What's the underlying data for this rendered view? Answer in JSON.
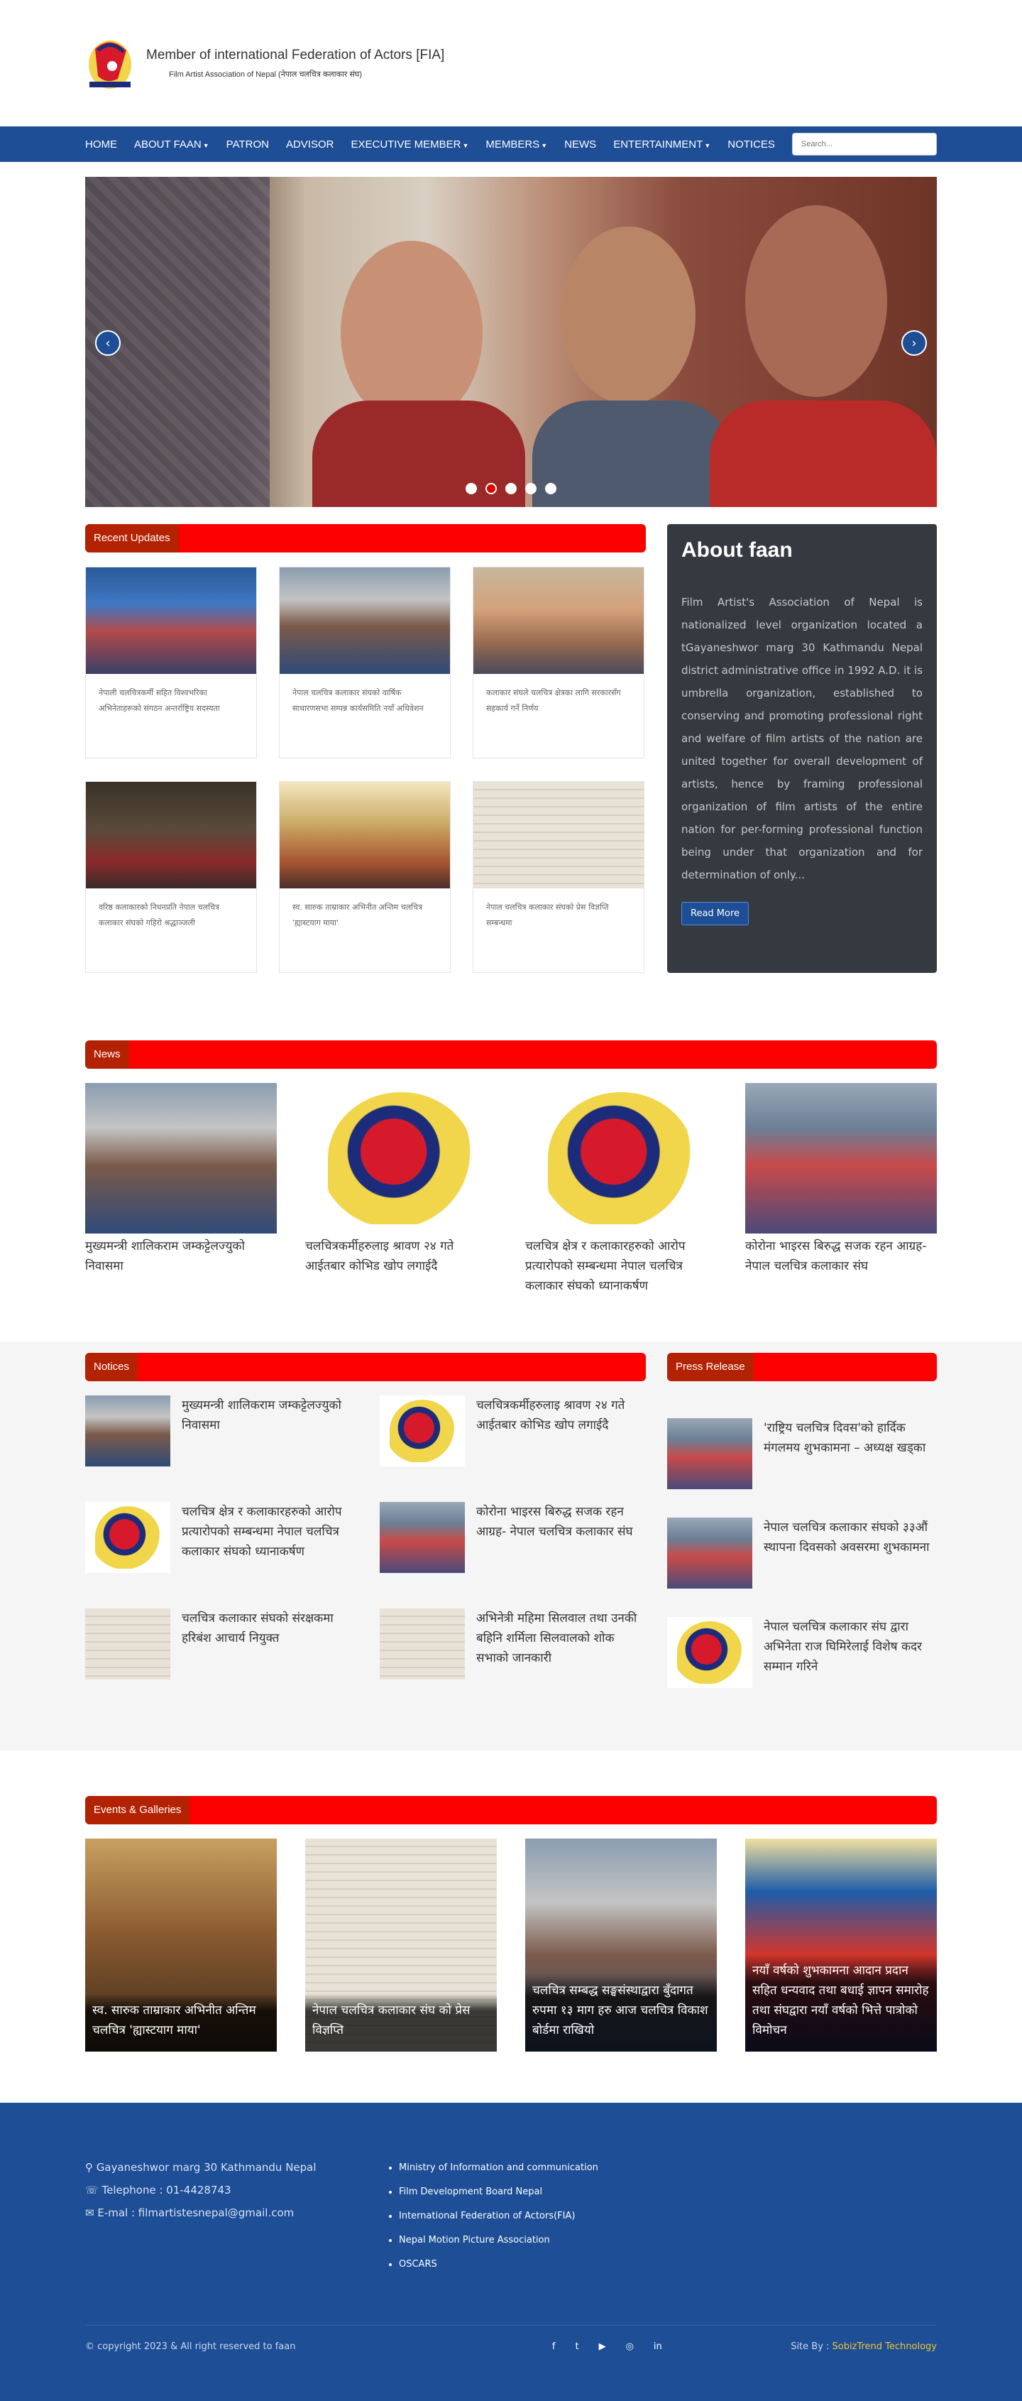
{
  "header": {
    "title": "Member of international Federation of Actors [FIA]",
    "subtitle": "Film Artist Association of Nepal (नेपाल चलचित्र कलाकार संघ)"
  },
  "nav": {
    "items": [
      {
        "label": "HOME",
        "dropdown": false
      },
      {
        "label": "ABOUT FAAN",
        "dropdown": true
      },
      {
        "label": "PATRON",
        "dropdown": false
      },
      {
        "label": "ADVISOR",
        "dropdown": false
      },
      {
        "label": "EXECUTIVE MEMBER",
        "dropdown": true
      },
      {
        "label": "MEMBERS",
        "dropdown": true
      },
      {
        "label": "NEWS",
        "dropdown": false
      },
      {
        "label": "ENTERTAINMENT",
        "dropdown": true
      },
      {
        "label": "NOTICES",
        "dropdown": false
      }
    ],
    "search_placeholder": "Search..."
  },
  "hero": {
    "prev_icon": "‹",
    "next_icon": "›",
    "slide_count": 5,
    "active_index": 1
  },
  "recent_updates": {
    "title": "Recent Updates",
    "cards": [
      {
        "text": "नेपाली चलचित्रकर्मी सहित विश्वभरिका अभिनेताहरूको संगठन अन्तर्राष्ट्रिय सदस्यता"
      },
      {
        "text": "नेपाल चलचित्र कलाकार संघको वार्षिक साधारणसभा सम्पन्न कार्यसमिति नयाँ अधिवेशन"
      },
      {
        "text": "कलाकार संघले चलचित्र क्षेत्रका लागि सरकारसँग सहकार्य गर्ने निर्णय"
      },
      {
        "text": "वरिष्ठ कलाकारको निधनप्रति नेपाल चलचित्र कलाकार संघको गहिरो श्रद्धाञ्जली"
      },
      {
        "text": "स्व. सारुक ताम्राकार अभिनीत अन्तिम चलचित्र 'ह्यास्टयाग माया'"
      },
      {
        "text": "नेपाल चलचित्र कलाकार संघको प्रेस विज्ञप्ति सम्बन्धमा"
      }
    ]
  },
  "about": {
    "title": "About faan",
    "text": "Film Artist's Association of Nepal is nationalized level organization located a tGayaneshwor marg 30 Kathmandu Nepal district administrative office in 1992 A.D. it is umbrella organization, established to conserving and promoting professional right and welfare of film artists of the nation are united together for overall development of artists, hence by framing professional organization of film artists of the entire nation for per-forming professional function being under that organization and for determination of only...",
    "button": "Read More"
  },
  "news": {
    "title": "News",
    "items": [
      {
        "title": "मुख्यमन्त्री शालिकराम जम्कट्टेलज्युको निवासमा",
        "image": "ph-group"
      },
      {
        "title": "चलचित्रकर्मीहरुलाइ श्रावण २४ गते आईतबार कोभिड खोप लगाईदै",
        "image": "ph-logo"
      },
      {
        "title": "चलचित्र क्षेत्र र कलाकारहरुको आरोप प्रत्यारोपको सम्बन्धमा नेपाल चलचित्र कलाकार संघको ध्यानाकर्षण",
        "image": "ph-logo"
      },
      {
        "title": "कोरोना भाइरस बिरुद्ध सजक रहन आग्रह- नेपाल चलचित्र कलाकार संघ",
        "image": "ph-crowd"
      }
    ]
  },
  "notices": {
    "title": "Notices",
    "items": [
      {
        "title": "मुख्यमन्त्री शालिकराम जम्कट्टेलज्युको निवासमा",
        "image": "ph-group"
      },
      {
        "title": "चलचित्रकर्मीहरुलाइ श्रावण २४ गते आईतबार कोभिड खोप लगाईदै",
        "image": "ph-logo"
      },
      {
        "title": "चलचित्र क्षेत्र र कलाकारहरुको आरोप प्रत्यारोपको सम्बन्धमा नेपाल चलचित्र कलाकार संघको ध्यानाकर्षण",
        "image": "ph-logo"
      },
      {
        "title": "कोरोना भाइरस बिरुद्ध सजक रहन आग्रह- नेपाल चलचित्र कलाकार संघ",
        "image": "ph-crowd"
      },
      {
        "title": "चलचित्र कलाकार संघको संरक्षकमा हरिबंश आचार्य नियुक्त",
        "image": "ph-paper"
      },
      {
        "title": "अभिनेत्री महिमा सिलवाल तथा उनकी बहिनि शर्मिला सिलवालको शोक सभाको जानकारी",
        "image": "ph-paper"
      }
    ]
  },
  "press": {
    "title": "Press Release",
    "items": [
      {
        "title": "'राष्ट्रिय चलचित्र दिवस'को हार्दिक मंगलमय शुभकामना – अध्यक्ष खड्का",
        "image": "ph-crowd"
      },
      {
        "title": "नेपाल चलचित्र कलाकार संघको ३३औं स्थापना दिवसको अवसरमा शुभकामना",
        "image": "ph-crowd"
      },
      {
        "title": "नेपाल चलचित्र कलाकार संघ द्वारा अभिनेता राज घिमिरेलाई विशेष कदर सम्मान गरिने",
        "image": "ph-logo"
      }
    ]
  },
  "events": {
    "title": "Events & Galleries",
    "items": [
      {
        "caption": "स्व. सारुक ताम्राकार अभिनीत अन्तिम चलचित्र 'ह्यास्टयाग माया'",
        "image": "ph-saruk"
      },
      {
        "caption": "नेपाल चलचित्र कलाकार संघ को प्रेस विज्ञप्ति",
        "image": "ph-paper"
      },
      {
        "caption": "चलचित्र सम्बद्ध सङ्घसंस्थाद्वारा बुँदागत रुपमा १३ माग हरु आज चलचित्र विकाश बोर्डमा राखियो",
        "image": "ph-group"
      },
      {
        "caption": "नयाँ वर्षको शुभकामना आदान प्रदान सहित धन्यवाद तथा बधाई ज्ञापन समारोह तथा संघद्वारा नयाँ वर्षको भित्ते पात्रोको विमोचन",
        "image": "ph-event4"
      }
    ]
  },
  "footer": {
    "address": "Gayaneshwor marg 30 Kathmandu Nepal",
    "telephone": "Telephone : 01-4428743",
    "email": "E-mal : filmartistesnepal@gmail.com",
    "links": [
      "Ministry of Information and communication",
      "Film Development Board Nepal",
      "International Federation of Actors(FIA)",
      "Nepal Motion Picture Association",
      "OSCARS"
    ],
    "copyright": "© copyright 2023 & All right reserved to faan",
    "socials": [
      "f",
      "t",
      "▶",
      "◎",
      "in"
    ],
    "credit_prefix": "Site By :",
    "credit_name": "SobizTrend Technology"
  },
  "colors": {
    "nav_blue": "#1d4e96",
    "section_red": "#fc0000",
    "section_tab": "#b32303",
    "about_bg": "#353a40",
    "credit_yellow": "#f4c430"
  }
}
